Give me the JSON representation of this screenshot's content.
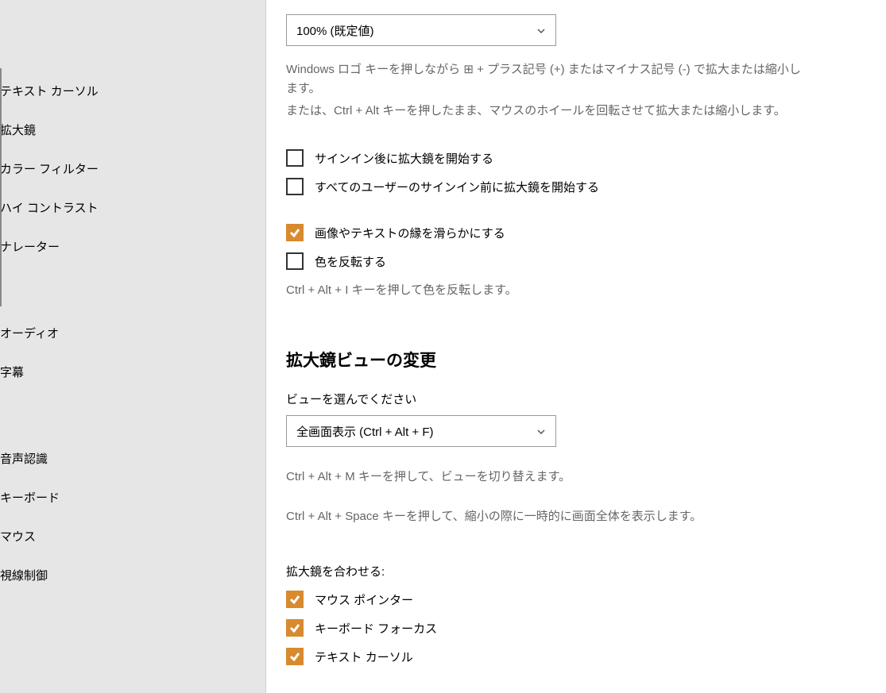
{
  "sidebar": {
    "items": [
      "テキスト カーソル",
      "拡大鏡",
      "カラー フィルター",
      "ハイ コントラスト",
      "ナレーター"
    ],
    "items2": [
      "オーディオ",
      "字幕"
    ],
    "items3": [
      "音声認識",
      "キーボード",
      "マウス",
      "視線制御"
    ]
  },
  "zoom": {
    "dropdown_value": "100% (既定値)",
    "help1": "Windows ロゴ キーを押しながら ⊞ + プラス記号 (+) またはマイナス記号 (-) で拡大または縮小します。",
    "help2": "または、Ctrl + Alt キーを押したまま、マウスのホイールを回転させて拡大または縮小します。"
  },
  "checkboxes": {
    "start_after_signin": "サインイン後に拡大鏡を開始する",
    "start_before_signin": "すべてのユーザーのサインイン前に拡大鏡を開始する",
    "smooth_edges": "画像やテキストの縁を滑らかにする",
    "invert_colors": "色を反転する",
    "invert_help": "Ctrl + Alt + I キーを押して色を反転します。"
  },
  "view": {
    "title": "拡大鏡ビューの変更",
    "label": "ビューを選んでください",
    "dropdown_value": "全画面表示 (Ctrl + Alt + F)",
    "help1": "Ctrl + Alt + M キーを押して、ビューを切り替えます。",
    "help2": "Ctrl + Alt + Space キーを押して、縮小の際に一時的に画面全体を表示します。"
  },
  "follow": {
    "label": "拡大鏡を合わせる:",
    "mouse": "マウス ポインター",
    "keyboard": "キーボード フォーカス",
    "cursor": "テキスト カーソル"
  }
}
